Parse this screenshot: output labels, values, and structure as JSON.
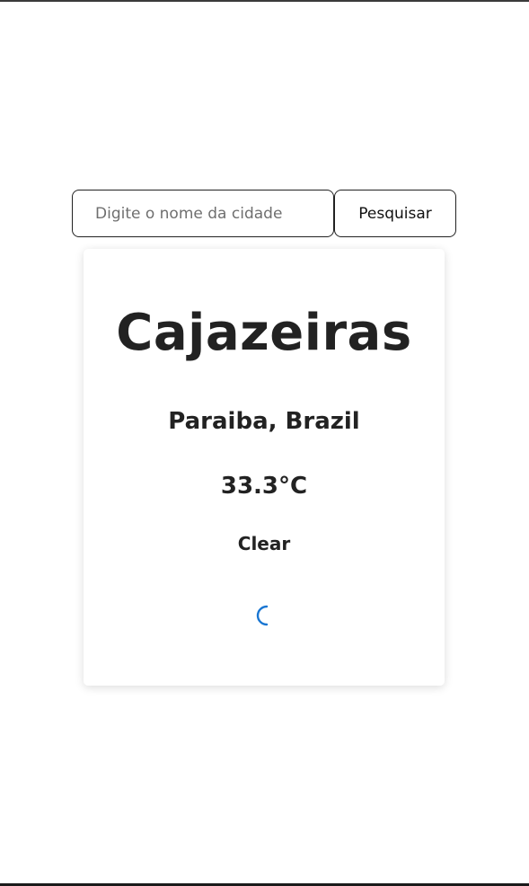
{
  "search": {
    "placeholder": "Digite o nome da cidade",
    "value": "",
    "button_label": "Pesquisar"
  },
  "weather": {
    "city": "Cajazeiras",
    "region": "Paraiba, Brazil",
    "temperature": "33.3°C",
    "condition": "Clear",
    "icon": "moon-icon",
    "icon_color": "#1976d2"
  }
}
